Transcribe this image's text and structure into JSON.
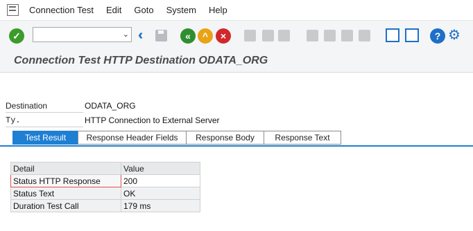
{
  "menu": {
    "items": [
      "Connection Test",
      "Edit",
      "Goto",
      "System",
      "Help"
    ]
  },
  "toolbar": {
    "command_field_value": "",
    "icons": [
      "enter-icon",
      "dropdown-icon",
      "double-left-icon",
      "save-icon",
      "back-icon",
      "exit-icon",
      "cancel-icon",
      "print-icon",
      "find-icon",
      "find-next-icon",
      "first-page-icon",
      "previous-page-icon",
      "next-page-icon",
      "last-page-icon",
      "new-session-icon",
      "create-shortcut-icon",
      "help-icon",
      "customize-icon"
    ]
  },
  "title": "Connection Test HTTP Destination ODATA_ORG",
  "fields": {
    "destination_label": "Destination",
    "destination_value": "ODATA_ORG",
    "type_label": "Ty.",
    "type_value": "HTTP Connection to External Server"
  },
  "tabs": [
    "Test Result",
    "Response Header Fields",
    "Response Body",
    "Response Text"
  ],
  "active_tab": 0,
  "table": {
    "headers": [
      "Detail",
      "Value"
    ],
    "rows": [
      [
        "Status HTTP Response",
        "200"
      ],
      [
        "Status Text",
        "OK"
      ],
      [
        "Duration Test Call",
        "179 ms"
      ]
    ]
  },
  "colors": {
    "accent": "#1e7fd3",
    "ok": "#3c9b2b",
    "exit": "#e8a317",
    "cancel": "#d0282c"
  }
}
